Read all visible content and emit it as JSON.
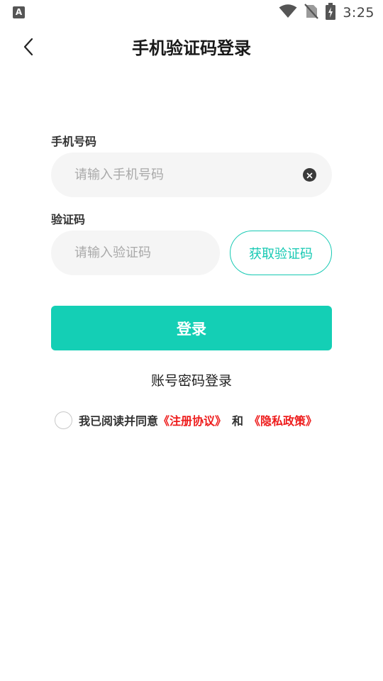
{
  "status_bar": {
    "app_icon_letter": "A",
    "time": "3:25"
  },
  "nav": {
    "title": "手机验证码登录"
  },
  "phone": {
    "label": "手机号码",
    "placeholder": "请输入手机号码",
    "value": ""
  },
  "code": {
    "label": "验证码",
    "placeholder": "请输入验证码",
    "value": "",
    "get_code_label": "获取验证码"
  },
  "login_button_label": "登录",
  "account_login_label": "账号密码登录",
  "agreement": {
    "checked": false,
    "prefix": "我已阅读并同意",
    "terms_link": "《注册协议》",
    "and": "和",
    "privacy_link": "《隐私政策》"
  },
  "colors": {
    "accent": "#14cfb5",
    "link_red": "#ee1c1c"
  }
}
